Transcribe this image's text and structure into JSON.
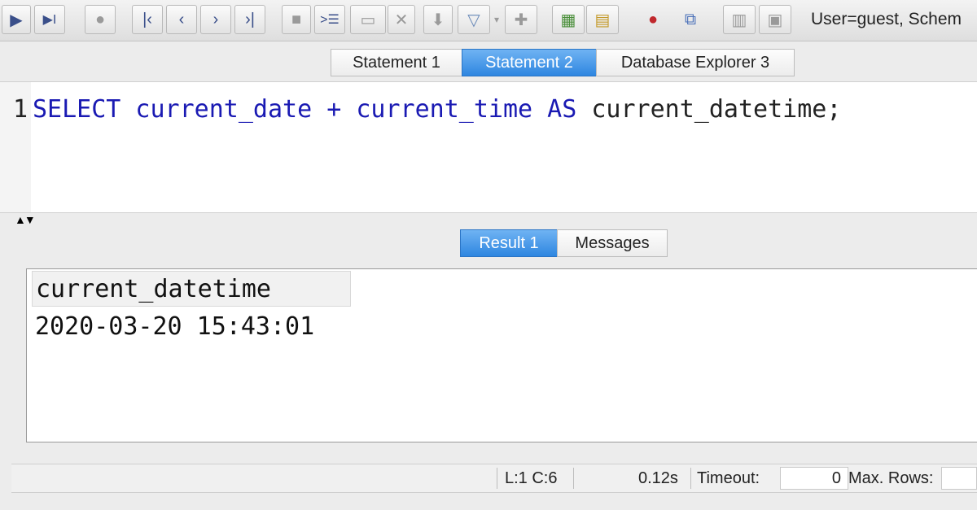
{
  "toolbar": {
    "icons": [
      "run-icon",
      "run-step-icon",
      "stop-icon",
      "first-icon",
      "prev-icon",
      "next-icon",
      "last-icon",
      "save-icon",
      "insert-row-icon",
      "edit-icon",
      "delete-icon",
      "pin-icon",
      "filter-icon",
      "clear-filter-icon",
      "new-sheet-icon",
      "open-icon",
      "disconnect-icon",
      "schema-icon",
      "copy-icon",
      "export-icon"
    ]
  },
  "connection_label": "User=guest, Schem",
  "tabs": [
    {
      "label": "Statement 1",
      "active": false
    },
    {
      "label": "Statement 2",
      "active": true
    },
    {
      "label": "Database Explorer 3",
      "active": false
    }
  ],
  "editor": {
    "line_number": "1",
    "kw_select": "SELECT",
    "expr1": " current_date + ",
    "kw_time": "current_time",
    "kw_as": " AS ",
    "alias": "current_datetime;"
  },
  "result_tabs": [
    {
      "label": "Result 1",
      "active": true
    },
    {
      "label": "Messages",
      "active": false
    }
  ],
  "result": {
    "columns": [
      "current_datetime"
    ],
    "rows": [
      [
        "2020-03-20 15:43:01"
      ]
    ]
  },
  "status": {
    "position": "L:1 C:6",
    "elapsed": "0.12s",
    "timeout_label": "Timeout:",
    "timeout_value": "0",
    "max_rows_label": "Max. Rows:"
  }
}
